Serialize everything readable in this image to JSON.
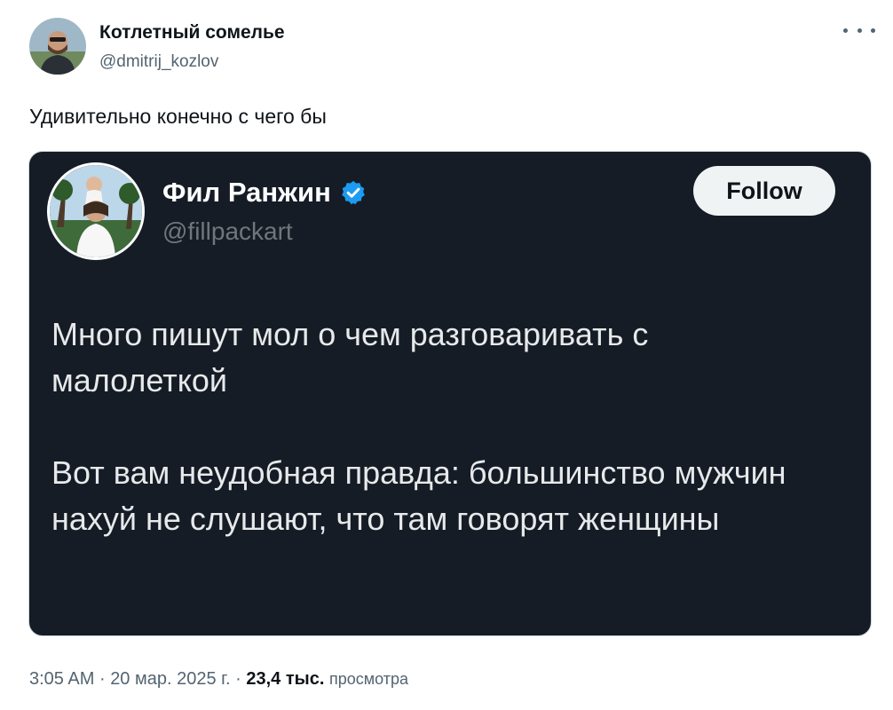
{
  "post": {
    "author": {
      "name": "Котлетный сомелье",
      "handle": "@dmitrij_kozlov",
      "avatar_icon": "user-avatar-photo"
    },
    "more_icon": "ellipsis-icon",
    "text": "Удивительно конечно с чего бы",
    "embedded": {
      "author": {
        "name": "Фил Ранжин",
        "handle": "@fillpackart",
        "verified": true,
        "verified_color": "#1d9bf0",
        "avatar_icon": "user-avatar-photo"
      },
      "follow_label": "Follow",
      "background_color": "#151c26",
      "paragraphs": [
        "Много пишут мол о чем разговаривать с малолеткой",
        "Вот вам неудобная правда: большинство мужчин нахуй не слушают, что там говорят женщины"
      ]
    },
    "meta": {
      "time": "3:05 AM",
      "separator": "·",
      "date": "20 мар. 2025 г.",
      "views_count": "23,4 тыс.",
      "views_label": "просмотра"
    }
  },
  "colors": {
    "text_primary": "#0f1419",
    "text_secondary": "#536471",
    "accent_verified": "#1d9bf0"
  }
}
